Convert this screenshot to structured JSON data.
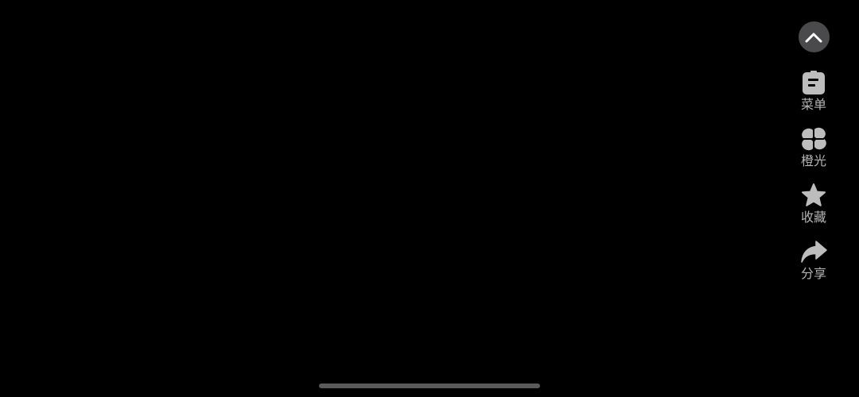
{
  "colors": {
    "background": "#000000",
    "icon": "#bdbdbd",
    "label": "#b4b4b4",
    "collapse_button_bg": "#4a4a4c",
    "home_indicator": "#5a5a5a"
  },
  "rail": {
    "collapse_icon": "chevron-up-icon",
    "items": [
      {
        "label": "菜单",
        "icon": "menu-icon"
      },
      {
        "label": "橙光",
        "icon": "orange-light-icon"
      },
      {
        "label": "收藏",
        "icon": "star-icon"
      },
      {
        "label": "分享",
        "icon": "share-icon"
      }
    ]
  }
}
